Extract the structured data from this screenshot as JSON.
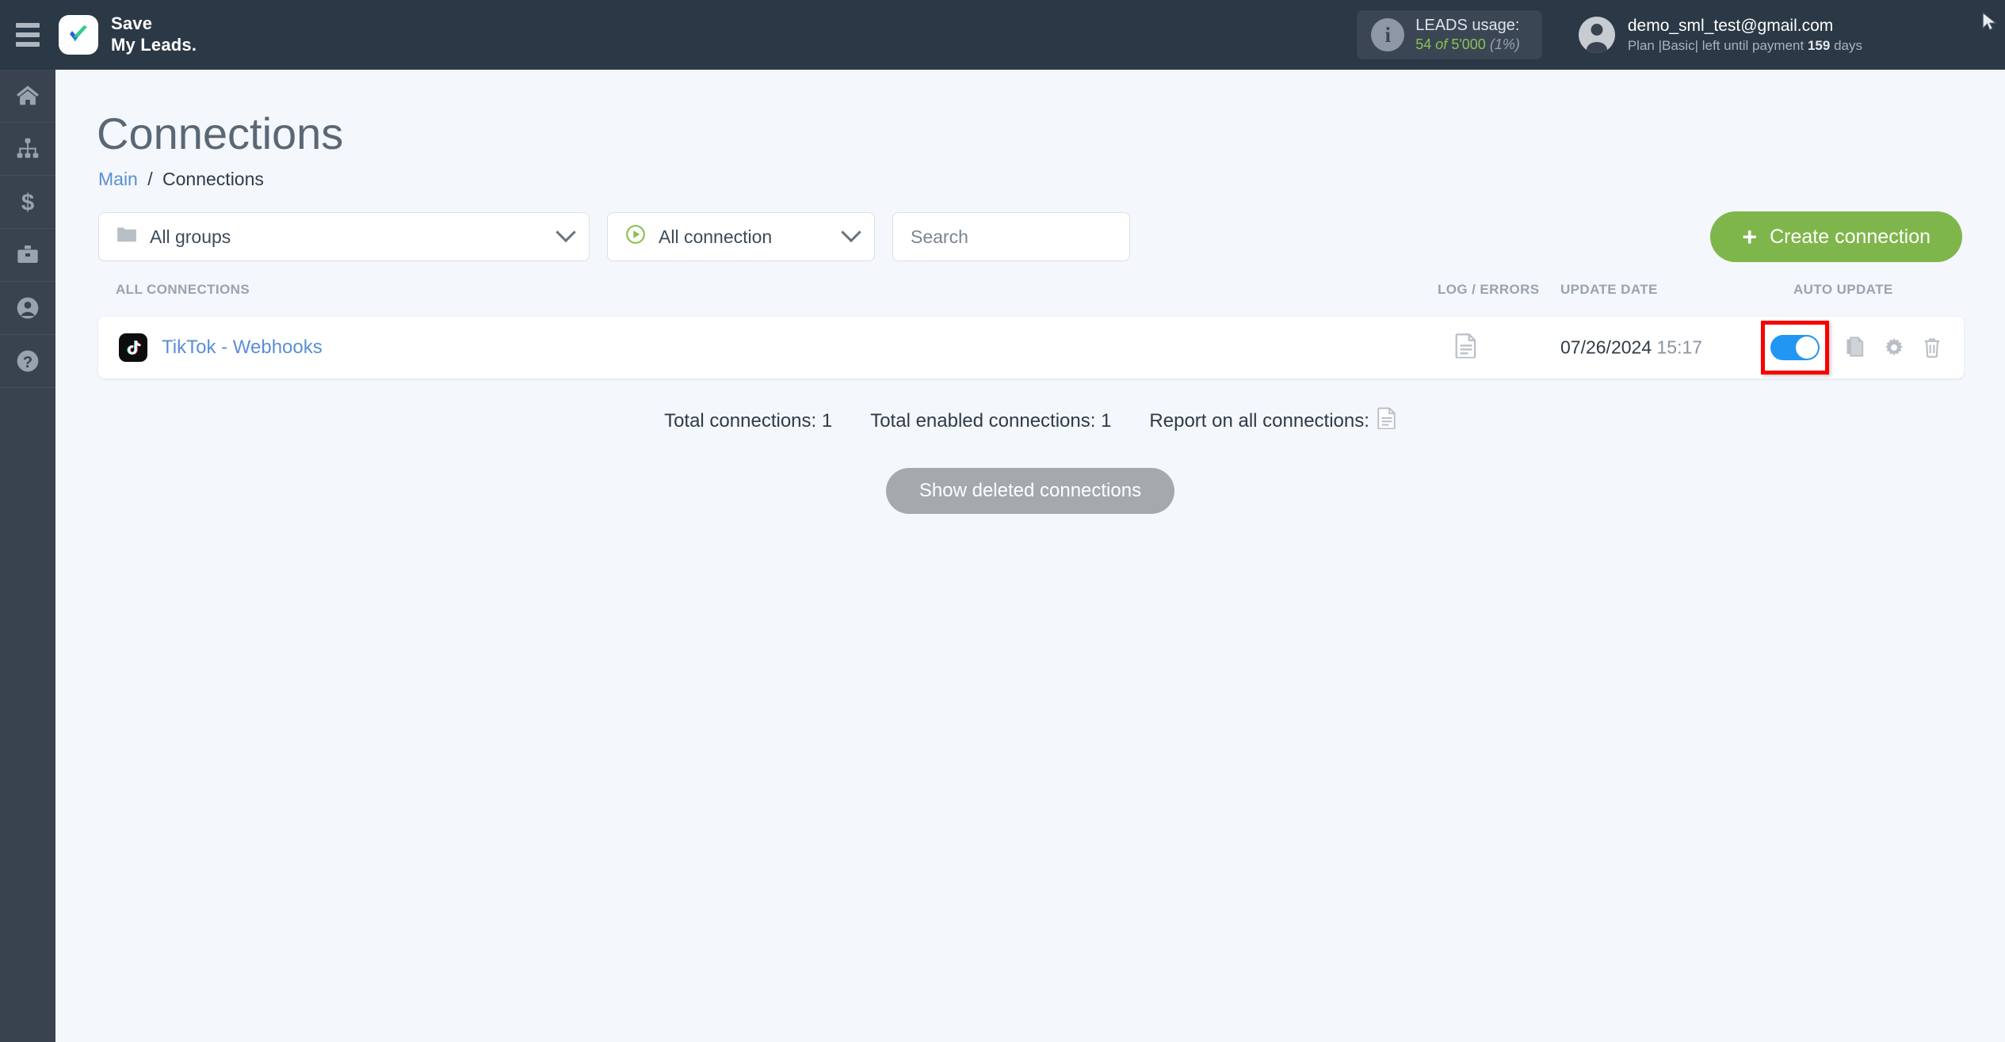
{
  "topbar": {
    "menu_icon": "hamburger-icon",
    "brand_line1": "Save",
    "brand_line2": "My Leads.",
    "usage": {
      "icon": "info-icon",
      "title": "LEADS usage:",
      "used": "54",
      "of": "of",
      "limit": "5'000",
      "percent": "(1%)"
    },
    "account": {
      "icon": "avatar-icon",
      "email": "demo_sml_test@gmail.com",
      "plan_prefix": "Plan |Basic| left until payment",
      "days_value": "159",
      "days_suffix": "days"
    }
  },
  "sidebar": {
    "items": [
      {
        "name": "home",
        "icon": "home-icon"
      },
      {
        "name": "connections",
        "icon": "sitemap-icon"
      },
      {
        "name": "billing",
        "icon": "dollar-icon"
      },
      {
        "name": "business",
        "icon": "briefcase-icon"
      },
      {
        "name": "profile",
        "icon": "user-circle-icon"
      },
      {
        "name": "help",
        "icon": "question-circle-icon"
      }
    ]
  },
  "page": {
    "title": "Connections",
    "breadcrumb": {
      "root": "Main",
      "separator": "/",
      "current": "Connections"
    }
  },
  "filters": {
    "groups_select": {
      "icon": "folder-icon",
      "value": "All groups",
      "chevron": "chevron-down-icon"
    },
    "connection_select": {
      "icon": "play-circle-icon",
      "value": "All connection",
      "chevron": "chevron-down-icon"
    },
    "search": {
      "value": "",
      "placeholder": "Search"
    },
    "create_button": {
      "plus": "+",
      "label": "Create connection"
    }
  },
  "table": {
    "headers": {
      "connections": "ALL CONNECTIONS",
      "log_errors": "LOG / ERRORS",
      "update_date": "UPDATE DATE",
      "auto_update": "AUTO UPDATE"
    },
    "rows": [
      {
        "service_icon": "tiktok-icon",
        "name": "TikTok - Webhooks",
        "log_icon": "document-icon",
        "date": "07/26/2024",
        "time": "15:17",
        "auto_update_on": true,
        "actions": [
          "copy-icon",
          "gear-icon",
          "trash-icon"
        ]
      }
    ]
  },
  "totals": {
    "total_connections": "Total connections: 1",
    "total_enabled": "Total enabled connections: 1",
    "report_label": "Report on all connections:",
    "report_icon": "document-icon"
  },
  "footer": {
    "show_deleted_label": "Show deleted connections"
  },
  "colors": {
    "topbar_bg": "#2b3845",
    "sidebar_bg": "#39434f",
    "page_bg": "#f4f7fb",
    "accent_green": "#7fb64b",
    "link_blue": "#5b8fd4",
    "toggle_blue": "#2196f3",
    "highlight_red": "#fb0000"
  }
}
